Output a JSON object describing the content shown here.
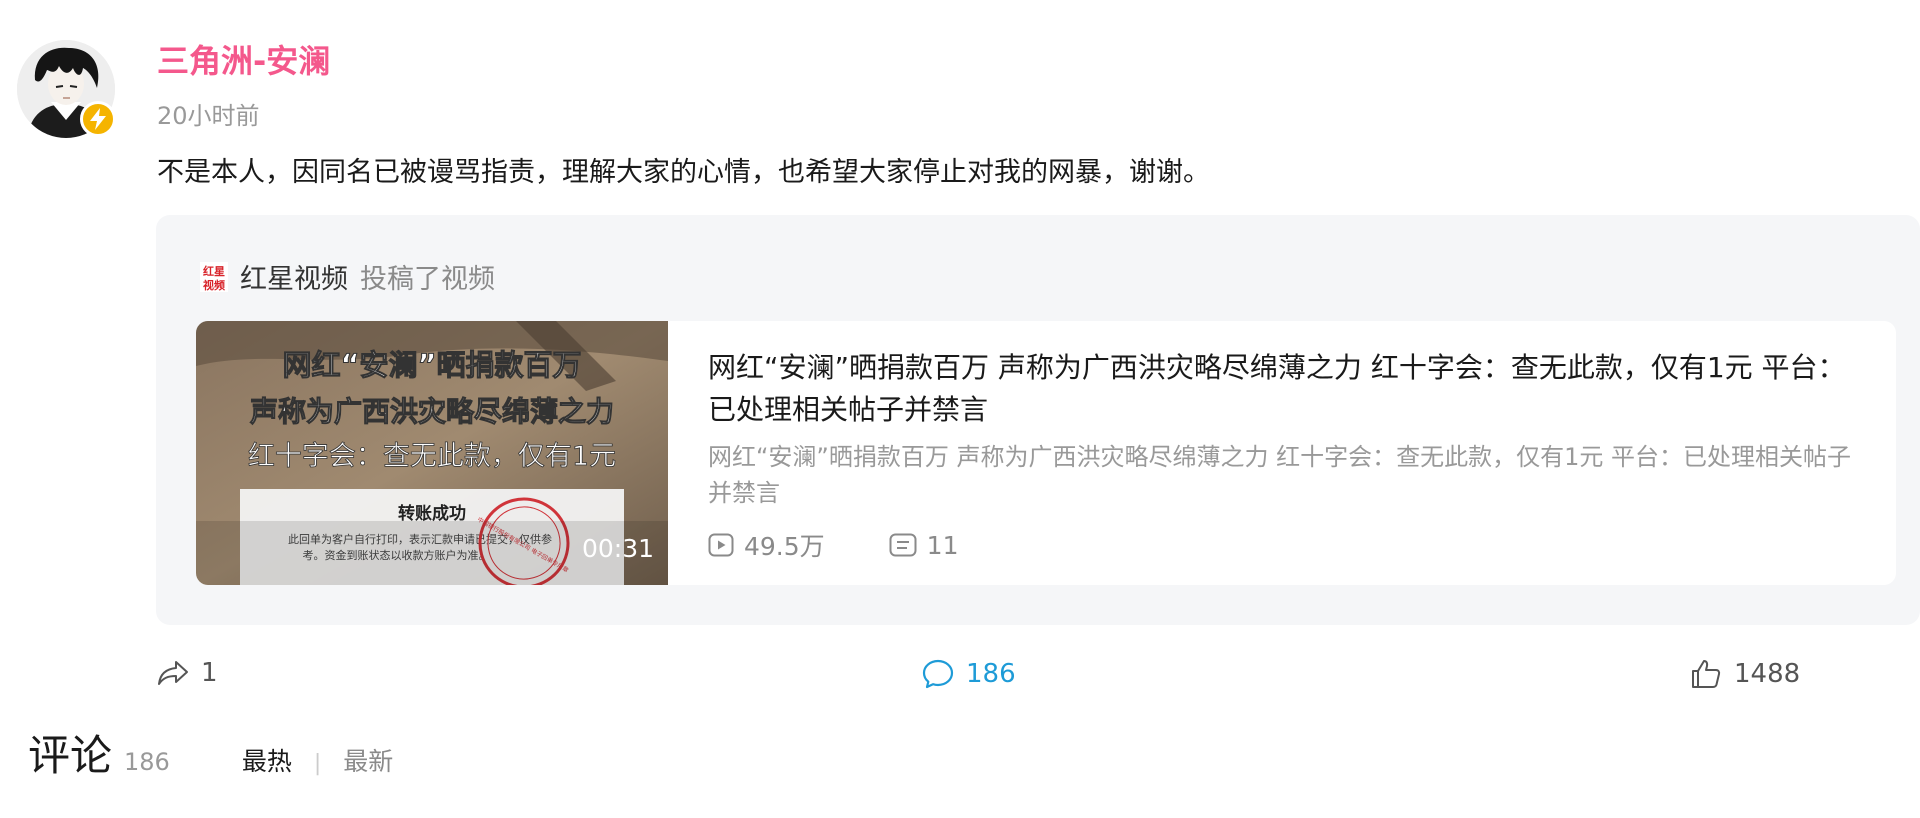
{
  "post": {
    "username": "三角洲-安澜",
    "timestamp": "20小时前",
    "text": "不是本人，因同名已被谩骂指责，理解大家的心情，也希望大家停止对我的网暴，谢谢。",
    "avatar_icon": "avatar-anime-character",
    "badge_icon": "lightning-icon",
    "username_color": "#f4588c"
  },
  "shared": {
    "source_logo_text": "红星视频",
    "source_name": "红星视频",
    "source_action": "投稿了视频",
    "video": {
      "thumbnail": {
        "line1": "网红“安澜”晒捐款百万",
        "line2": "声称为广西洪灾略尽绵薄之力",
        "line3": "红十字会：查无此款，仅有1元",
        "receipt_title": "转账成功",
        "receipt_text_1": "此回单为客户自行打印，表示汇款申请已提交，仅供参",
        "receipt_text_2": "考。资金到账状态以收款方账户为准。",
        "stamp_text": "中国银行股份有限公司 电子回单专用章"
      },
      "duration": "00:31",
      "title": "网红“安澜”晒捐款百万 声称为广西洪灾略尽绵薄之力 红十字会：查无此款，仅有1元 平台：已处理相关帖子并禁言",
      "description": "网红“安澜”晒捐款百万 声称为广西洪灾略尽绵薄之力 红十字会：查无此款，仅有1元 平台：已处理相关帖子并禁言",
      "views": "49.5万",
      "danmaku": "11"
    }
  },
  "actions": {
    "share_count": "1",
    "comment_count": "186",
    "like_count": "1488",
    "comment_color": "#1e9bd7"
  },
  "comments": {
    "title": "评论",
    "count": "186",
    "sort_hot": "最热",
    "sort_sep": "|",
    "sort_new": "最新"
  }
}
